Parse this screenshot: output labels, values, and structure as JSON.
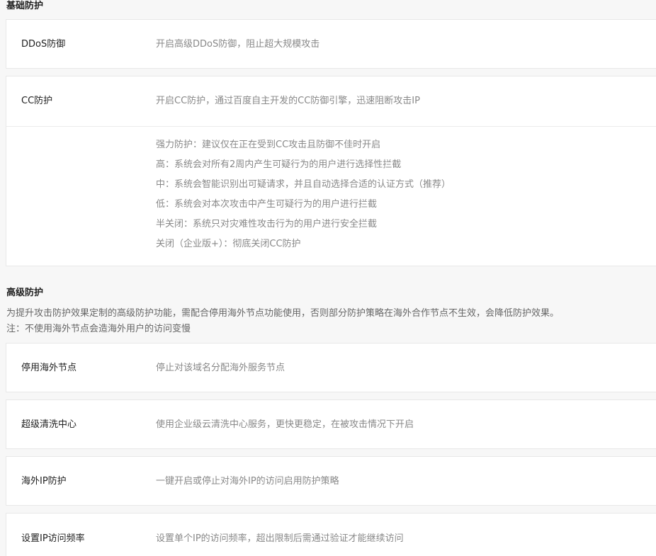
{
  "basic": {
    "title": "基础防护",
    "ddos": {
      "label": "DDoS防御",
      "desc": "开启高级DDoS防御，阻止超大规模攻击"
    },
    "cc": {
      "label": "CC防护",
      "desc": "开启CC防护，通过百度自主开发的CC防御引擎，迅速阻断攻击IP",
      "levels": [
        "强力防护：建议仅在正在受到CC攻击且防御不佳时开启",
        "高：系统会对所有2周内产生可疑行为的用户进行选择性拦截",
        "中：系统会智能识别出可疑请求，并且自动选择合适的认证方式（推荐）",
        "低：系统会对本次攻击中产生可疑行为的用户进行拦截",
        "半关闭：系统只对灾难性攻击行为的用户进行安全拦截",
        "关闭（企业版+）：彻底关闭CC防护"
      ]
    }
  },
  "advanced": {
    "title": "高级防护",
    "desc": "为提升攻击防护效果定制的高级防护功能，需配合停用海外节点功能使用，否则部分防护策略在海外合作节点不生效，会降低防护效果。",
    "note": "注：不使用海外节点会造海外用户的访问变慢",
    "items": [
      {
        "label": "停用海外节点",
        "desc": "停止对该域名分配海外服务节点"
      },
      {
        "label": "超级清洗中心",
        "desc": "使用企业级云清洗中心服务，更快更稳定，在被攻击情况下开启"
      },
      {
        "label": "海外IP防护",
        "desc": "一键开启或停止对海外IP的访问启用防护策略"
      },
      {
        "label": "设置IP访问频率",
        "desc": "设置单个IP的访问频率，超出限制后需通过验证才能继续访问"
      }
    ]
  }
}
